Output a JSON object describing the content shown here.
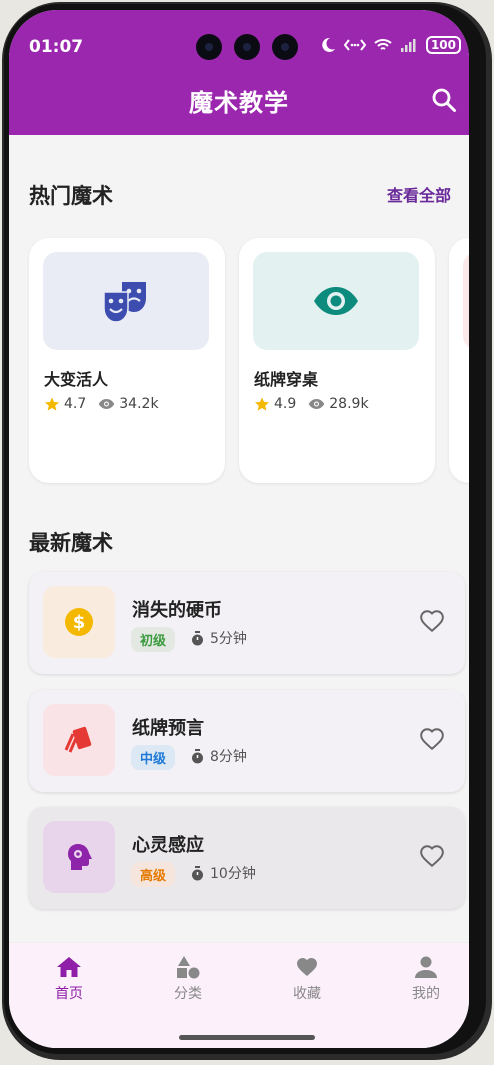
{
  "status": {
    "time": "01:07",
    "battery": "100"
  },
  "app": {
    "title": "魔术教学"
  },
  "hot": {
    "title": "热门魔术",
    "see_all": "查看全部",
    "items": [
      {
        "name": "大变活人",
        "rating": "4.7",
        "views": "34.2k",
        "icon": "theater-masks-icon",
        "bg": "#e9ecf5"
      },
      {
        "name": "纸牌穿桌",
        "rating": "4.9",
        "views": "28.9k",
        "icon": "eye-icon",
        "bg": "#e3f1f1"
      }
    ]
  },
  "latest": {
    "title": "最新魔术",
    "items": [
      {
        "name": "消失的硬币",
        "level": "初级",
        "duration": "5分钟",
        "icon": "coin-icon"
      },
      {
        "name": "纸牌预言",
        "level": "中级",
        "duration": "8分钟",
        "icon": "cards-icon"
      },
      {
        "name": "心灵感应",
        "level": "高级",
        "duration": "10分钟",
        "icon": "mind-icon"
      }
    ]
  },
  "nav": {
    "items": [
      {
        "label": "首页",
        "icon": "home-icon",
        "active": true
      },
      {
        "label": "分类",
        "icon": "category-icon"
      },
      {
        "label": "收藏",
        "icon": "heart-icon"
      },
      {
        "label": "我的",
        "icon": "person-icon"
      }
    ]
  },
  "colors": {
    "primary": "#9b27af",
    "accent": "#6a2a9a",
    "star": "#f5b800"
  }
}
